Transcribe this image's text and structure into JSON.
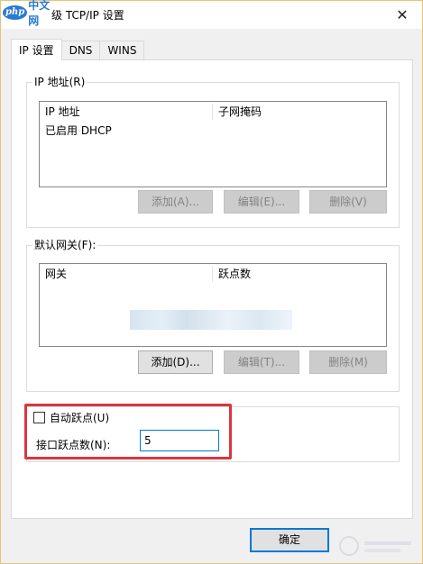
{
  "window": {
    "title": "级 TCP/IP 设置",
    "logo_latin": "php",
    "logo_cn": "中文网"
  },
  "tabs": [
    {
      "label": "IP 设置",
      "active": true
    },
    {
      "label": "DNS",
      "active": false
    },
    {
      "label": "WINS",
      "active": false
    }
  ],
  "ip_group": {
    "legend": "IP 地址(R)",
    "columns": [
      "IP 地址",
      "子网掩码"
    ],
    "rows": [
      "已启用 DHCP"
    ],
    "add_label": "添加(A)...",
    "edit_label": "编辑(E)...",
    "delete_label": "删除(V)"
  },
  "gateway_group": {
    "legend": "默认网关(F):",
    "columns": [
      "网关",
      "跃点数"
    ],
    "add_label": "添加(D)...",
    "edit_label": "编辑(T)...",
    "delete_label": "删除(M)"
  },
  "metric": {
    "auto_label": "自动跃点(U)",
    "auto_checked": false,
    "interface_label": "接口跃点数(N):",
    "value": "5"
  },
  "footer": {
    "ok_label": "确定"
  },
  "colors": {
    "highlight": "#d9363e",
    "focus": "#0078d7",
    "brand": "#2a7ad4"
  }
}
